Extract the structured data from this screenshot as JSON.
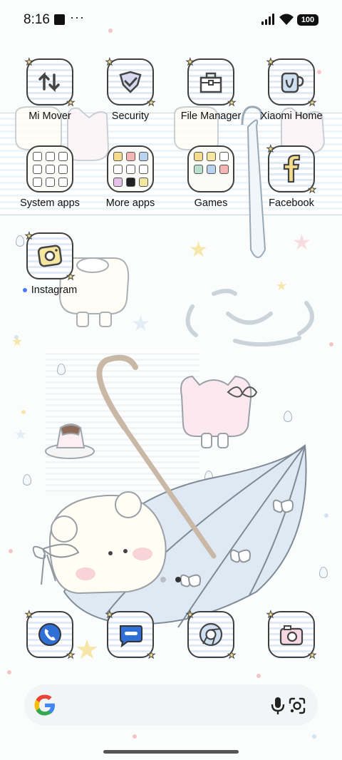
{
  "status_bar": {
    "time": "8:16",
    "overflow": "···",
    "battery": "100"
  },
  "home_rows": [
    [
      {
        "label": "Mi Mover",
        "icon": "mi-mover-icon"
      },
      {
        "label": "Security",
        "icon": "security-shield-icon"
      },
      {
        "label": "File Manager",
        "icon": "file-manager-icon"
      },
      {
        "label": "Xiaomi Home",
        "icon": "xiaomi-home-icon"
      }
    ],
    [
      {
        "label": "System apps",
        "icon": "folder-icon"
      },
      {
        "label": "More apps",
        "icon": "folder-icon"
      },
      {
        "label": "Games",
        "icon": "folder-icon"
      },
      {
        "label": "Facebook",
        "icon": "facebook-icon"
      }
    ],
    [
      {
        "label": "Instagram",
        "icon": "instagram-icon"
      }
    ]
  ],
  "dock": [
    {
      "icon": "phone-icon"
    },
    {
      "icon": "messages-icon"
    },
    {
      "icon": "chrome-icon"
    },
    {
      "icon": "camera-icon"
    }
  ],
  "search": {
    "logo": "google-g-icon",
    "mic": "mic-icon",
    "lens": "lens-icon"
  },
  "colors": {
    "accent_yellow": "#f3dc8c",
    "tile_stripe": "#dfeaf5",
    "new_dot": "#4b7bf0"
  }
}
